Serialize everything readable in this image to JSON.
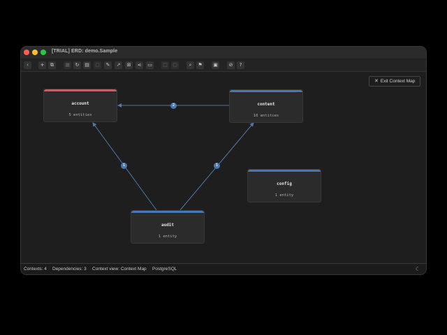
{
  "window": {
    "title": "[TRIAL] ERD: demo.Sample"
  },
  "toolbar": {
    "buttons": [
      {
        "icon": "chevron-left-icon",
        "glyph": "‹"
      },
      {
        "icon": "add-icon",
        "glyph": "+"
      },
      {
        "icon": "duplicate-icon",
        "glyph": "⧉"
      },
      {
        "icon": "table-icon",
        "glyph": "▦"
      },
      {
        "icon": "refresh-icon",
        "glyph": "↻"
      },
      {
        "icon": "layout-icon",
        "glyph": "▤"
      },
      {
        "icon": "document-icon",
        "glyph": "▢"
      },
      {
        "icon": "edit-icon",
        "glyph": "✎"
      },
      {
        "icon": "export-icon",
        "glyph": "↗"
      },
      {
        "icon": "grid-icon",
        "glyph": "⊞"
      },
      {
        "icon": "share-icon",
        "glyph": "⋖"
      },
      {
        "icon": "folder-icon",
        "glyph": "▭"
      },
      {
        "icon": "square-icon",
        "glyph": "□"
      },
      {
        "icon": "square-alt-icon",
        "glyph": "▢"
      },
      {
        "icon": "search-icon",
        "glyph": "⌕"
      },
      {
        "icon": "flag-icon",
        "glyph": "⚑"
      },
      {
        "icon": "image-icon",
        "glyph": "▣"
      },
      {
        "icon": "link-icon",
        "glyph": "⊘"
      },
      {
        "icon": "help-icon",
        "glyph": "?"
      }
    ]
  },
  "canvas": {
    "exit_button": {
      "label": "Exit Context Map",
      "icon": "close-icon",
      "glyph": "✕"
    },
    "nodes": [
      {
        "id": "account",
        "name": "account",
        "count": "5 entities",
        "color": "#c0606a"
      },
      {
        "id": "content",
        "name": "content",
        "count": "10 entities",
        "color": "#4a78b0"
      },
      {
        "id": "config",
        "name": "config",
        "count": "1 entity",
        "color": "#4a78b0"
      },
      {
        "id": "audit",
        "name": "audit",
        "count": "1 entity",
        "color": "#4a78b0"
      }
    ],
    "edges": [
      {
        "from": "content",
        "to": "account",
        "label": "2"
      },
      {
        "from": "audit",
        "to": "account",
        "label": "1"
      },
      {
        "from": "audit",
        "to": "content",
        "label": "1"
      }
    ],
    "edge_color": "#4f7aa8"
  },
  "status": {
    "contexts": "Contexts: 4",
    "dependencies": "Dependencies: 3",
    "view": "Context view: Context Map",
    "database": "PostgreSQL",
    "theme_icon": "moon-icon",
    "theme_glyph": "☾"
  }
}
